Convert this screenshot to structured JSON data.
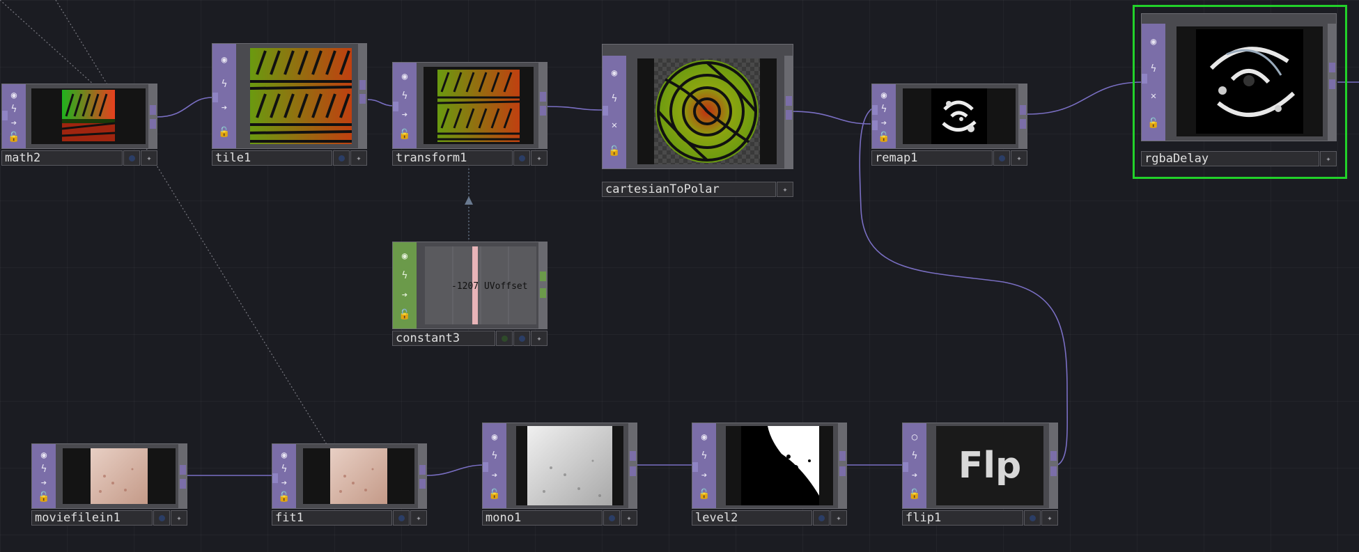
{
  "nodes": {
    "math2": {
      "name": "math2"
    },
    "tile1": {
      "name": "tile1"
    },
    "transform1": {
      "name": "transform1"
    },
    "cartesianToPolar": {
      "name": "cartesianToPolar"
    },
    "remap1": {
      "name": "remap1"
    },
    "rgbaDelay": {
      "name": "rgbaDelay"
    },
    "constant3": {
      "name": "constant3",
      "value": "-1207",
      "channel": "UVoffset"
    },
    "moviefilein1": {
      "name": "moviefilein1"
    },
    "fit1": {
      "name": "fit1"
    },
    "mono1": {
      "name": "mono1"
    },
    "level2": {
      "name": "level2"
    },
    "flip1": {
      "name": "flip1",
      "preview_text": "Flp"
    }
  },
  "colors": {
    "background": "#1b1c22",
    "top_family": "#7b6ea8",
    "chop_family": "#6b9a4a",
    "wire": "#7a6fc4",
    "selection": "#22d12a"
  },
  "icons": [
    "viewer-toggle-icon",
    "cook-icon",
    "pass-through-icon",
    "lock-icon",
    "bypass-icon",
    "display-flag-icon",
    "clone-icon"
  ]
}
